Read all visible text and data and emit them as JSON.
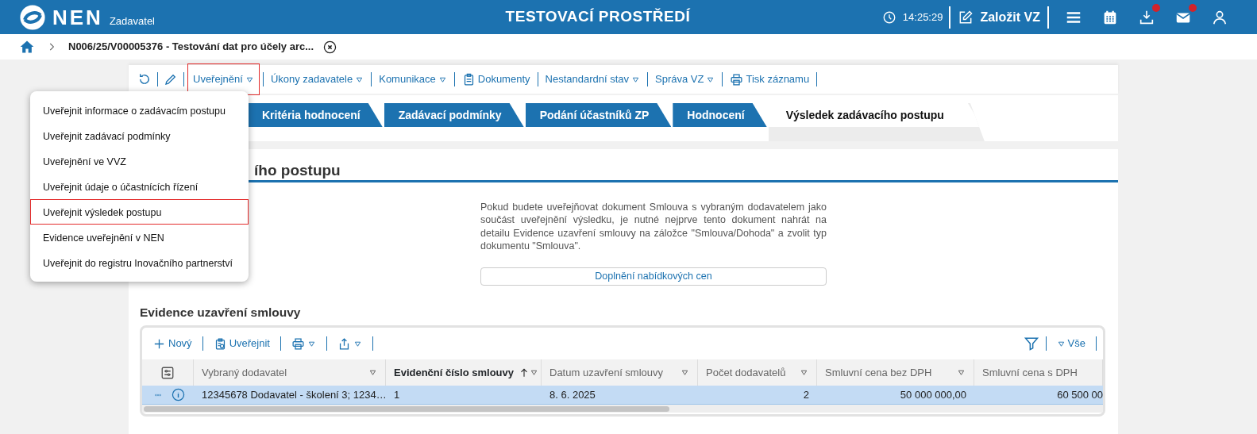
{
  "header": {
    "logo": "NEN",
    "logo_sub": "Zadavatel",
    "title": "TESTOVACÍ PROSTŘEDÍ",
    "time": "14:25:29",
    "create_label": "Založit VZ",
    "icons": [
      {
        "kind": "menu",
        "alert": false
      },
      {
        "kind": "calendar",
        "alert": false
      },
      {
        "kind": "download",
        "alert": true
      },
      {
        "kind": "mail",
        "alert": true
      },
      {
        "kind": "user",
        "alert": false
      }
    ]
  },
  "breadcrumb": {
    "text": "N006/25/V00005376 - Testování dat pro účely arc..."
  },
  "toolbar": [
    {
      "kind": "refresh"
    },
    {
      "kind": "edit"
    },
    {
      "kind": "menu",
      "label": "Uveřejnění",
      "has_menu": true,
      "selected": true
    },
    {
      "kind": "menu",
      "label": "Úkony zadavatele",
      "has_menu": true,
      "selected": false
    },
    {
      "kind": "menu",
      "label": "Komunikace",
      "has_menu": true,
      "selected": false
    },
    {
      "kind": "documents",
      "label": "Dokumenty",
      "has_menu": false,
      "selected": false
    },
    {
      "kind": "menu",
      "label": "Nestandardní stav",
      "has_menu": true,
      "selected": false
    },
    {
      "kind": "menu",
      "label": "Správa VZ",
      "has_menu": true,
      "selected": false
    },
    {
      "kind": "print",
      "label": "Tisk záznamu",
      "has_menu": false,
      "selected": false
    }
  ],
  "dropdown": [
    {
      "label": "Uveřejnit informace o zadávacím postupu",
      "selected": false
    },
    {
      "label": "Uveřejnit zadávací podmínky",
      "selected": false
    },
    {
      "label": "Uveřejnění ve VVZ",
      "selected": false
    },
    {
      "label": "Uveřejnit údaje o účastnících řízení",
      "selected": false
    },
    {
      "label": "Uveřejnit výsledek postupu",
      "selected": true
    },
    {
      "label": "Evidence uveřejnění v NEN",
      "selected": false
    },
    {
      "label": "Uveřejnit do registru Inovačního partnerství",
      "selected": false
    }
  ],
  "tabs": [
    {
      "label": "Kritéria hodnocení",
      "selected": false
    },
    {
      "label": "Zadávací podmínky",
      "selected": false
    },
    {
      "label": "Podání účastníků ZP",
      "selected": false
    },
    {
      "label": "Hodnocení",
      "selected": false
    },
    {
      "label": "Výsledek zadávacího postupu",
      "selected": true
    }
  ],
  "section_heading": "ího postupu",
  "info_text": "Pokud budete uveřejňovat dokument Smlouva s vybraným dodavatelem jako součást uveřejnění výsledku, je nutné nejprve tento dokument nahrát na detailu Evidence uzavření smlouvy na záložce \"Smlouva/Dohoda\" a zvolit typ dokumentu \"Smlouva\".",
  "info_button": "Doplnění nabídkových cen",
  "grid": {
    "title": "Evidence uzavření smlouvy",
    "actions": [
      {
        "kind": "new",
        "label": "Nový",
        "has_menu": false
      },
      {
        "kind": "publish",
        "label": "Uveřejnit",
        "has_menu": false
      },
      {
        "kind": "print",
        "has_menu": true
      },
      {
        "kind": "export",
        "has_menu": true
      }
    ],
    "filter_label": "Vše",
    "columns": [
      {
        "label": "Vybraný dodavatel",
        "sorted": false,
        "filter": true
      },
      {
        "label": "Evidenční číslo smlouvy",
        "sorted": true,
        "filter": true
      },
      {
        "label": "Datum uzavření smlouvy",
        "sorted": false,
        "filter": true
      },
      {
        "label": "Počet dodavatelů",
        "sorted": false,
        "filter": true
      },
      {
        "label": "Smluvní cena bez DPH",
        "sorted": false,
        "filter": true
      },
      {
        "label": "Smluvní cena s DPH",
        "sorted": false,
        "filter": false
      }
    ],
    "rows": [
      {
        "selected": true,
        "cells": [
          "12345678 Dodavatel - školení 3; 1234…",
          "1",
          "8. 6. 2025",
          "2",
          "50 000 000,00",
          "60 500 00"
        ]
      }
    ]
  }
}
